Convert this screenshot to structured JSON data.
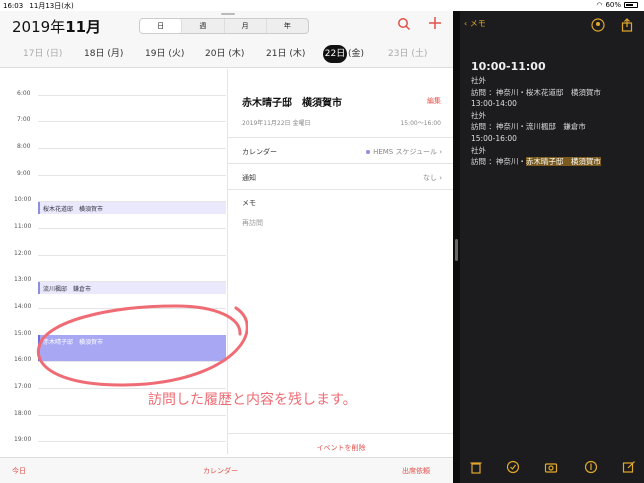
{
  "status_bar": {
    "time": "16:03",
    "date": "11月13日(水)",
    "battery": "60%"
  },
  "calendar": {
    "month_year_prefix": "2019年",
    "month": "11月",
    "view_tabs": [
      "日",
      "週",
      "月",
      "年"
    ],
    "active_view": "日",
    "days": [
      "17日 (日)",
      "18日 (月)",
      "19日 (火)",
      "20日 (木)",
      "21日 (木)",
      "22日",
      "(金)",
      "23日 (土)"
    ],
    "hours": [
      "6:00",
      "7:00",
      "8:00",
      "9:00",
      "10:00",
      "11:00",
      "12:00",
      "13:00",
      "14:00",
      "15:00",
      "16:00",
      "17:00",
      "18:00",
      "19:00"
    ],
    "events": [
      {
        "label": "桜木花道邸　横須賀市",
        "style": "light"
      },
      {
        "label": "流川楓邸　鎌倉市",
        "style": "light"
      },
      {
        "label": "赤木晴子邸　横須賀市",
        "style": "strong"
      }
    ],
    "detail": {
      "title": "赤木晴子邸　横須賀市",
      "edit": "編集",
      "date": "2019年11月22日 金曜日",
      "time": "15:00～16:00",
      "calendar_label": "カレンダー",
      "calendar_value": "HEMS スケジュール",
      "calendar_color": "#8d8de8",
      "alert_label": "通知",
      "alert_value": "なし",
      "memo_label": "メモ",
      "memo_value": "再訪問",
      "delete": "イベントを削除"
    },
    "footer": {
      "today": "今日",
      "calendars": "カレンダー",
      "inbox": "出席依頼"
    },
    "annotation": "訪問した履歴と内容を残します。",
    "accent_color": "#e2504a"
  },
  "notes": {
    "back_label": "メモ",
    "heading": "10:00-11:00",
    "lines": [
      "社外",
      "訪問 ：神奈川・桜木花道邸　横須賀市",
      "13:00-14:00",
      "社外",
      "訪問 ：神奈川・流川楓邸　鎌倉市",
      "15:00-16:00",
      "社外"
    ],
    "last_line_prefix": "訪問 ：神奈川・",
    "last_line_highlight": "赤木晴子邸　横須賀市",
    "accent_color": "#e1a92c"
  }
}
